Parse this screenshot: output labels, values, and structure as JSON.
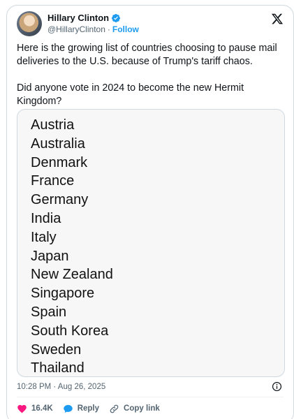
{
  "author": {
    "display_name": "Hillary Clinton",
    "handle": "@HillaryClinton",
    "separator": "·",
    "follow_label": "Follow"
  },
  "tweet": {
    "text_1": "Here is the growing list of countries choosing to pause mail deliveries to the U.S. because of Trump's tariff chaos.",
    "text_2": "Did anyone vote in 2024 to become the new Hermit Kingdom?"
  },
  "media": {
    "countries": [
      "Austria",
      "Australia",
      "Denmark",
      "France",
      "Germany",
      "India",
      "Italy",
      "Japan",
      "New Zealand",
      "Singapore",
      "Spain",
      "South Korea",
      "Sweden",
      "Thailand"
    ]
  },
  "meta": {
    "timestamp": "10:28 PM · Aug 26, 2025"
  },
  "actions": {
    "likes": "16.4K",
    "reply_label": "Reply",
    "copy_link_label": "Copy link"
  },
  "colors": {
    "accent": "#1d9bf0",
    "like": "#f91880",
    "secondary_text": "#536471"
  },
  "icons": [
    "verified-badge-icon",
    "x-logo-icon",
    "info-icon",
    "heart-icon",
    "reply-bubble-icon",
    "link-icon"
  ]
}
